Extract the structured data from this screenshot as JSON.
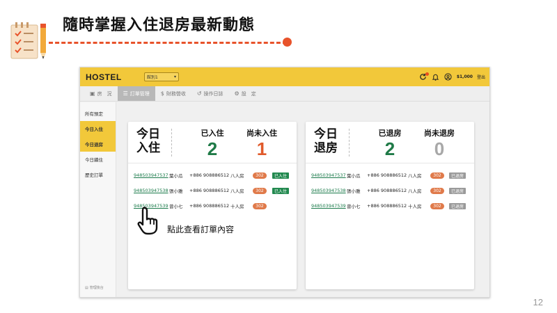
{
  "slide": {
    "title": "隨時掌握入住退房最新動態",
    "page_number": "12"
  },
  "colors": {
    "accent_yellow": "#f2c83a",
    "accent_orange": "#e8532b",
    "checked_in_green": "#22894f",
    "checked_out_gray": "#9a9a9a"
  },
  "app": {
    "brand": "HOSTEL",
    "building_select": "館別1",
    "balance": "$1,000",
    "logout": "登出",
    "tabs": [
      {
        "label": "房　況",
        "icon": "calendar-icon",
        "active": false
      },
      {
        "label": "訂單管理",
        "icon": "list-icon",
        "active": true
      },
      {
        "label": "財務營收",
        "icon": "dollar-icon",
        "active": false
      },
      {
        "label": "操作日誌",
        "icon": "history-icon",
        "active": false
      },
      {
        "label": "設　定",
        "icon": "gear-icon",
        "active": false
      }
    ],
    "sidebar": {
      "items": [
        {
          "label": "所有預定",
          "active": false
        },
        {
          "label": "今日入住",
          "active": true
        },
        {
          "label": "今日退房",
          "active": true
        },
        {
          "label": "今日續住",
          "active": false
        },
        {
          "label": "歷史訂單",
          "active": false
        }
      ],
      "footer": "管理後台"
    }
  },
  "checkin": {
    "title": "今日入住",
    "done_label": "已入住",
    "done_value": "2",
    "pending_label": "尚未入住",
    "pending_value": "1",
    "rows": [
      {
        "id": "948503947537",
        "name": "葉小瓜",
        "phone": "+886 908886512",
        "room": "八人房",
        "room_no": "302",
        "status": "已入住"
      },
      {
        "id": "948503947538",
        "name": "張小雅",
        "phone": "+886 908886512",
        "room": "八人房",
        "room_no": "302",
        "status": "已入住"
      },
      {
        "id": "948503947539",
        "name": "曾小七",
        "phone": "+886 908886512",
        "room": "十人房",
        "room_no": "302",
        "status": ""
      }
    ]
  },
  "checkout": {
    "title": "今日退房",
    "done_label": "已退房",
    "done_value": "2",
    "pending_label": "尚未退房",
    "pending_value": "0",
    "rows": [
      {
        "id": "948503947537",
        "name": "葉小瓜",
        "phone": "+886 908886512",
        "room": "八人房",
        "room_no": "302",
        "status": "已退房"
      },
      {
        "id": "948503947538",
        "name": "張小雅",
        "phone": "+886 908886512",
        "room": "八人房",
        "room_no": "302",
        "status": "已退房"
      },
      {
        "id": "948503947539",
        "name": "曾小七",
        "phone": "+886 908886512",
        "room": "十人房",
        "room_no": "302",
        "status": "已退房"
      }
    ]
  },
  "hint": "點此查看訂單內容"
}
